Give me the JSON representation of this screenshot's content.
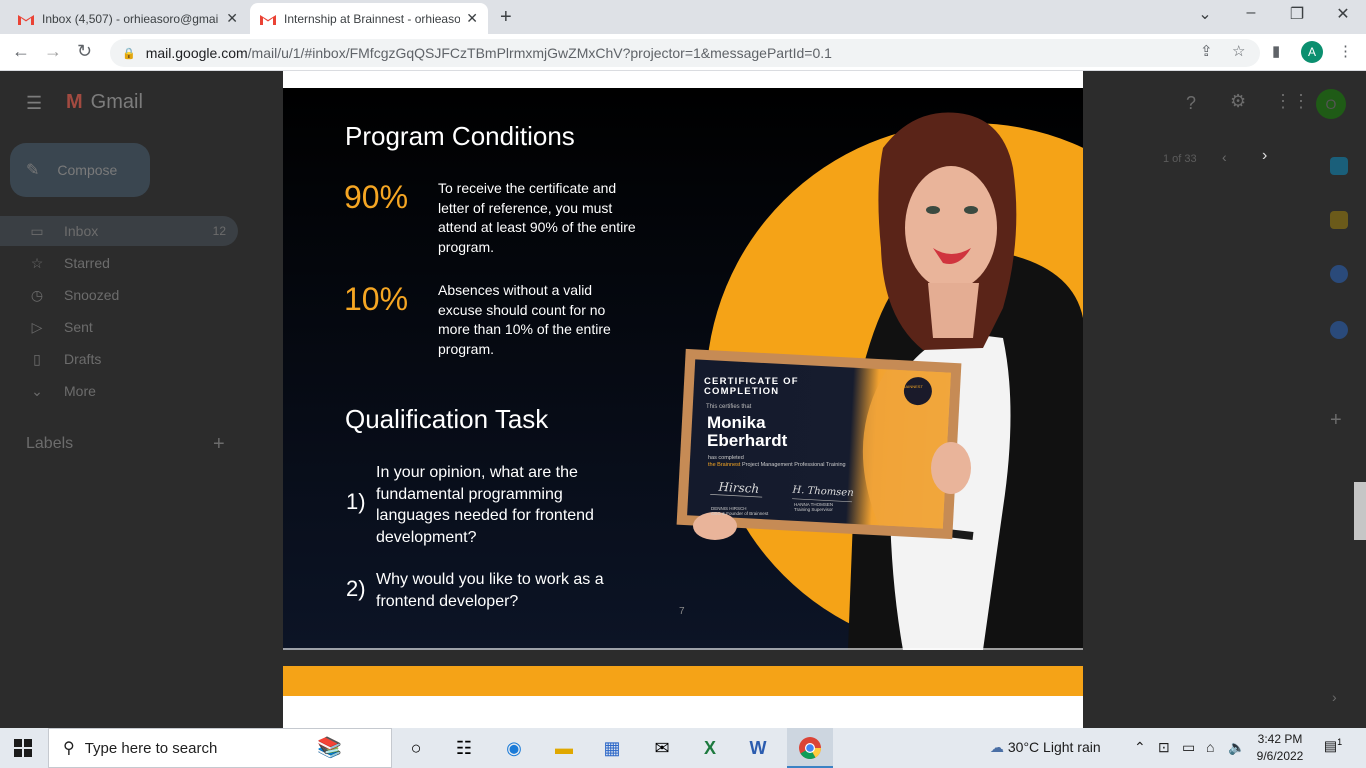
{
  "browser": {
    "tabs": [
      {
        "title": "Inbox (4,507) - orhieasoro@gmai",
        "active": false
      },
      {
        "title": "Internship at Brainnest - orhieaso",
        "active": true
      }
    ],
    "url_host": "mail.google.com",
    "url_rest": "/mail/u/1/#inbox/FMfcgzGqQSJFCzTBmPlrmxmjGwZMxChV?projector=1&messagePartId=0.1",
    "profile_letter": "A",
    "new_tab": "+"
  },
  "gmail": {
    "logo": "Gmail",
    "compose_label": "Compose",
    "nav": [
      {
        "label": "Inbox",
        "count": "12"
      },
      {
        "label": "Starred",
        "count": ""
      },
      {
        "label": "Snoozed",
        "count": ""
      },
      {
        "label": "Sent",
        "count": ""
      },
      {
        "label": "Drafts",
        "count": ""
      },
      {
        "label": "More",
        "count": ""
      }
    ],
    "labels_heading": "Labels",
    "pager": "1 of 33",
    "avatar_letter": "O"
  },
  "slide": {
    "heading_conditions": "Program Conditions",
    "conditions": [
      {
        "percent": "90%",
        "text": "To receive the certificate and letter of reference, you must attend at least 90% of the entire program."
      },
      {
        "percent": "10%",
        "text": "Absences without a valid excuse should count for no more than 10% of the entire program."
      }
    ],
    "heading_task": "Qualification Task",
    "questions": [
      {
        "number": "1)",
        "text": "In your opinion, what are the fundamental programming languages needed for frontend development?"
      },
      {
        "number": "2)",
        "text": "Why would you like to work as a frontend developer?"
      }
    ],
    "page_number": "7",
    "certificate": {
      "title": "CERTIFICATE OF COMPLETION",
      "certifies": "This certifies that",
      "name": "Monika Eberhardt",
      "completed": "has completed",
      "program_brand": "the Brainnest",
      "program_rest": " Project Management Professional Training",
      "brand": "BRAINNEST",
      "signer_left": "DENNIS HIRSCH",
      "signer_left_role": "CEO & Founder of Brainnest",
      "signer_right": "HANNA THOMSEN",
      "signer_right_role": "Training Supervisor"
    },
    "accent_color": "#f5a623"
  },
  "taskbar": {
    "search_placeholder": "Type here to search",
    "weather": "30°C  Light rain",
    "time": "3:42 PM",
    "date": "9/6/2022",
    "notification_count": "1"
  }
}
